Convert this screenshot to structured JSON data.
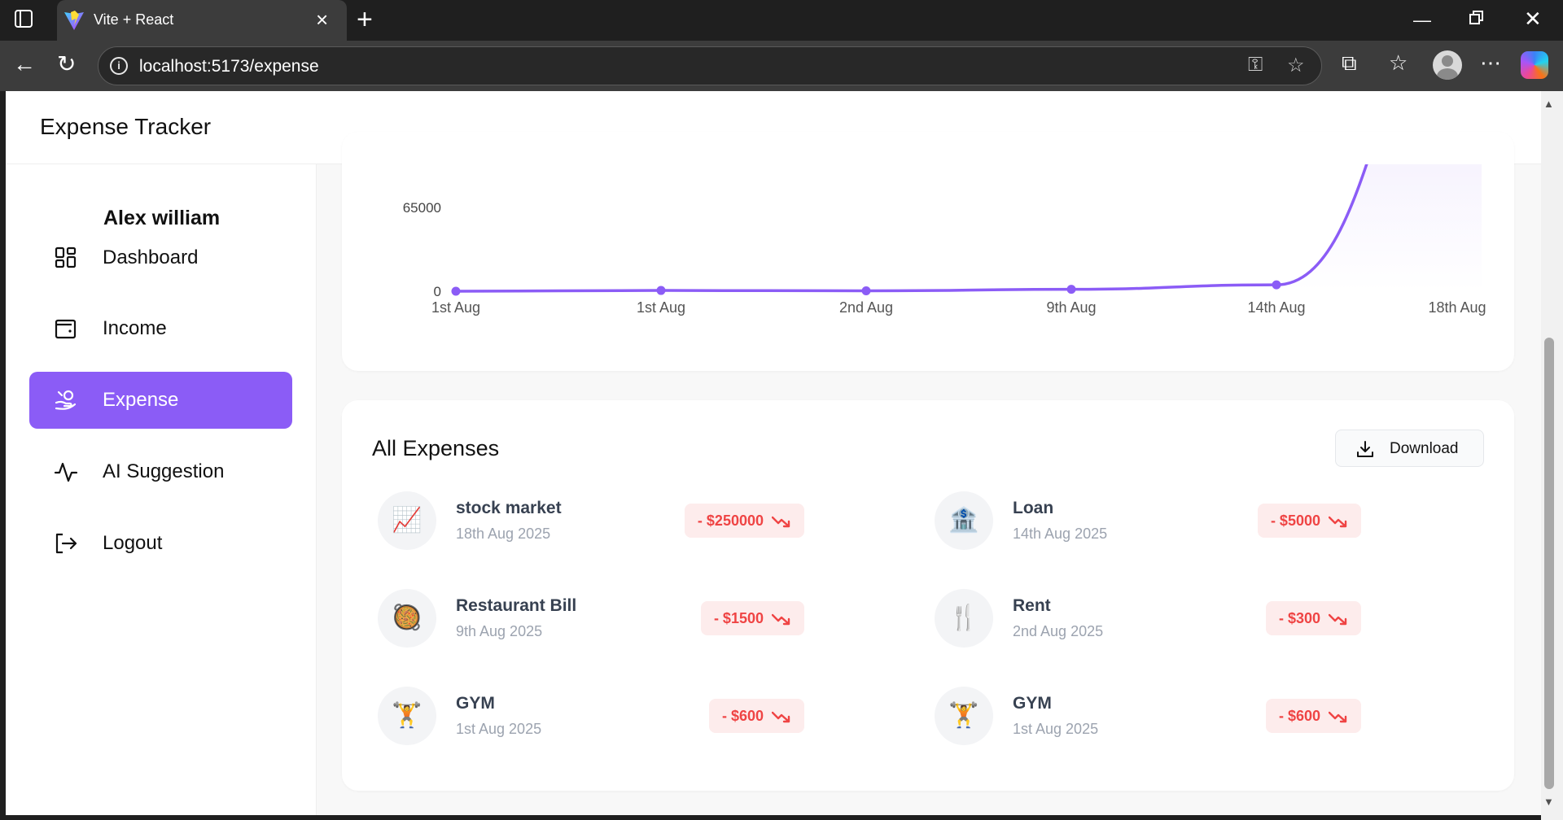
{
  "browser": {
    "tab_title": "Vite + React",
    "url": "localhost:5173/expense"
  },
  "app": {
    "title": "Expense Tracker",
    "user_name": "Alex william"
  },
  "sidebar": {
    "items": [
      {
        "label": "Dashboard",
        "icon": "dashboard-icon",
        "active": false
      },
      {
        "label": "Income",
        "icon": "wallet-icon",
        "active": false
      },
      {
        "label": "Expense",
        "icon": "hand-coins-icon",
        "active": true
      },
      {
        "label": "AI Suggestion",
        "icon": "activity-icon",
        "active": false
      },
      {
        "label": "Logout",
        "icon": "logout-icon",
        "active": false
      }
    ]
  },
  "chart_data": {
    "type": "area",
    "x": [
      "1st Aug",
      "1st Aug",
      "2nd Aug",
      "9th Aug",
      "14th Aug",
      "18th Aug"
    ],
    "values": [
      0,
      600,
      300,
      1500,
      5000,
      250000
    ],
    "y_tick_labels": [
      "0",
      "65000"
    ],
    "color": "#8b5cf6"
  },
  "expenses": {
    "title": "All Expenses",
    "download_label": "Download",
    "items": [
      {
        "title": "stock market",
        "date": "18th Aug 2025",
        "amount": "- $250000",
        "icon": "📈"
      },
      {
        "title": "Loan",
        "date": "14th Aug 2025",
        "amount": "- $5000",
        "icon": "🏦"
      },
      {
        "title": "Restaurant Bill",
        "date": "9th Aug 2025",
        "amount": "- $1500",
        "icon": "🥘"
      },
      {
        "title": "Rent",
        "date": "2nd Aug 2025",
        "amount": "- $300",
        "icon": "🍴"
      },
      {
        "title": "GYM",
        "date": "1st Aug 2025",
        "amount": "- $600",
        "icon": "🏋"
      },
      {
        "title": "GYM",
        "date": "1st Aug 2025",
        "amount": "- $600",
        "icon": "🏋"
      }
    ]
  },
  "colors": {
    "accent": "#8b5cf6",
    "expense_red": "#ef4444",
    "expense_bg": "#fdecec"
  }
}
